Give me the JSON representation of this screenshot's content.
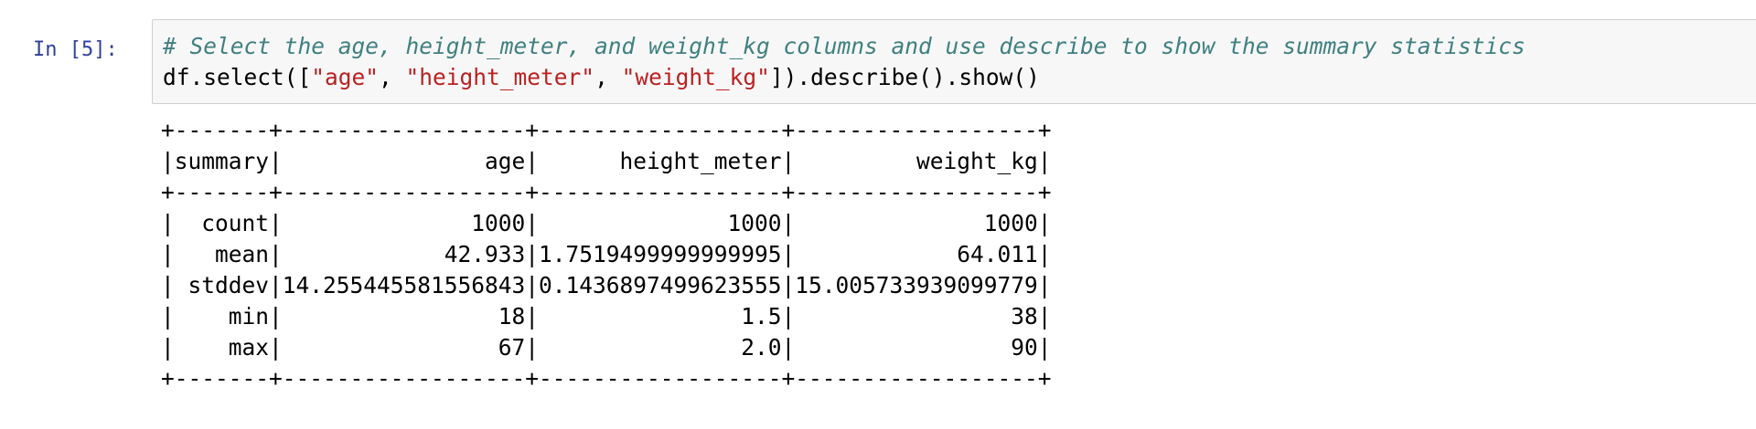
{
  "cell": {
    "prompt": "In [5]:",
    "code": {
      "comment": "# Select the age, height_meter, and weight_kg columns and use describe to show the summary statistics",
      "line2_prefix": "df.select([",
      "arg1": "\"age\"",
      "sep1": ", ",
      "arg2": "\"height_meter\"",
      "sep2": ", ",
      "arg3": "\"weight_kg\"",
      "line2_suffix": "]).describe().show()"
    }
  },
  "output": {
    "lines": [
      "+-------+------------------+------------------+------------------+",
      "|summary|               age|      height_meter|         weight_kg|",
      "+-------+------------------+------------------+------------------+",
      "|  count|              1000|              1000|              1000|",
      "|   mean|            42.933|1.7519499999999995|            64.011|",
      "| stddev|14.255445581556843|0.1436897499623555|15.005733939099779|",
      "|    min|                18|               1.5|                38|",
      "|    max|                67|               2.0|                90|",
      "+-------+------------------+------------------+------------------+"
    ]
  },
  "colors": {
    "prompt": "#303f9f",
    "comment": "#408080",
    "string": "#ba2121",
    "input_background": "#f7f7f7",
    "input_border": "#cfcfcf"
  }
}
